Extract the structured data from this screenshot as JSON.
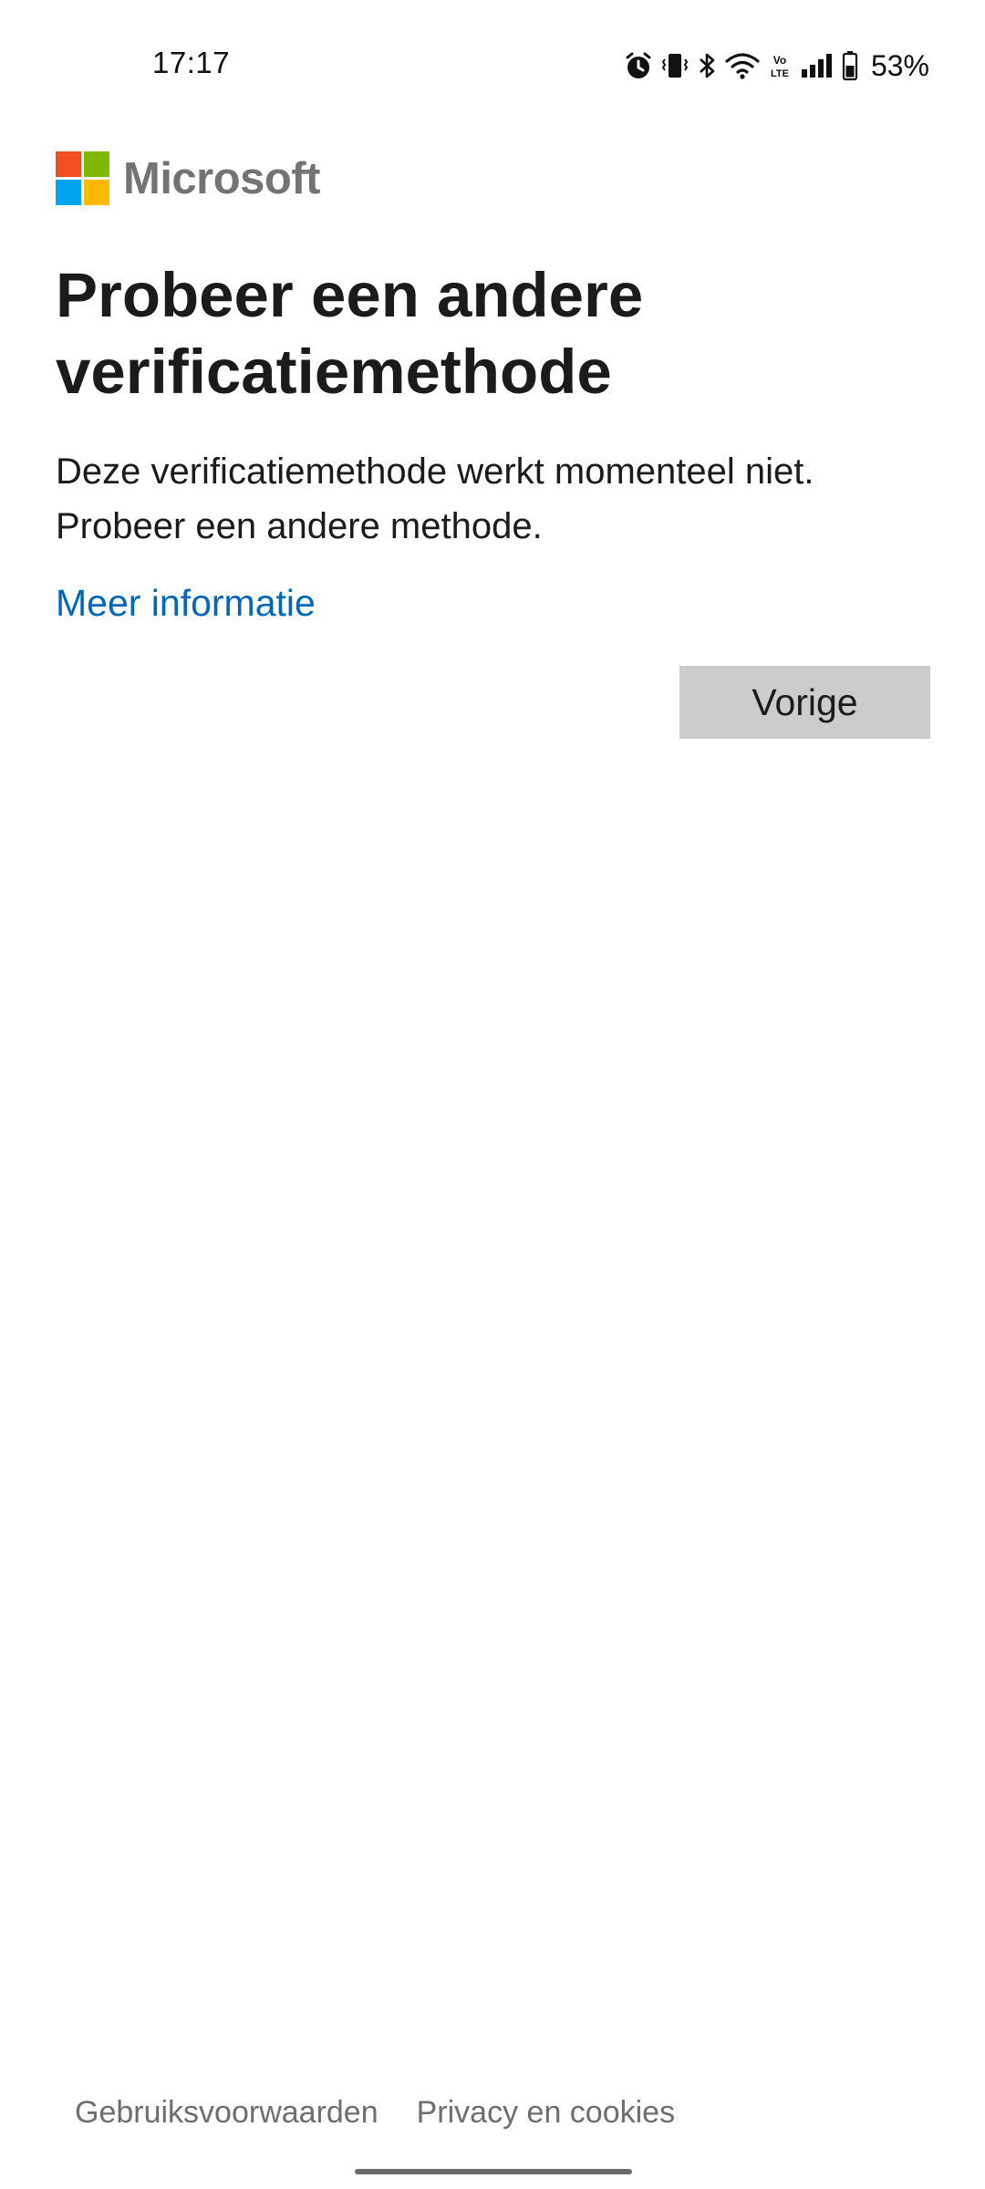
{
  "status_bar": {
    "time": "17:17",
    "battery_percent": "53%",
    "icons": [
      "alarm-icon",
      "vibrate-icon",
      "bluetooth-icon",
      "wifi-icon",
      "volte-icon",
      "signal-icon",
      "battery-icon"
    ],
    "volte_text": "Vo LTE"
  },
  "brand": {
    "name": "Microsoft",
    "colors": {
      "red": "#f25022",
      "green": "#7fba00",
      "blue": "#00a4ef",
      "yellow": "#ffb900"
    }
  },
  "main": {
    "title": "Probeer een andere verificatiemethode",
    "description": "Deze verificatiemethode werkt momenteel niet. Probeer een andere methode.",
    "more_info_link": "Meer informatie",
    "back_button": "Vorige"
  },
  "footer": {
    "terms_link": "Gebruiksvoorwaarden",
    "privacy_link": "Privacy en cookies"
  },
  "colors": {
    "link": "#0067b8",
    "button_bg": "#cccccc",
    "text": "#1b1b1b"
  }
}
